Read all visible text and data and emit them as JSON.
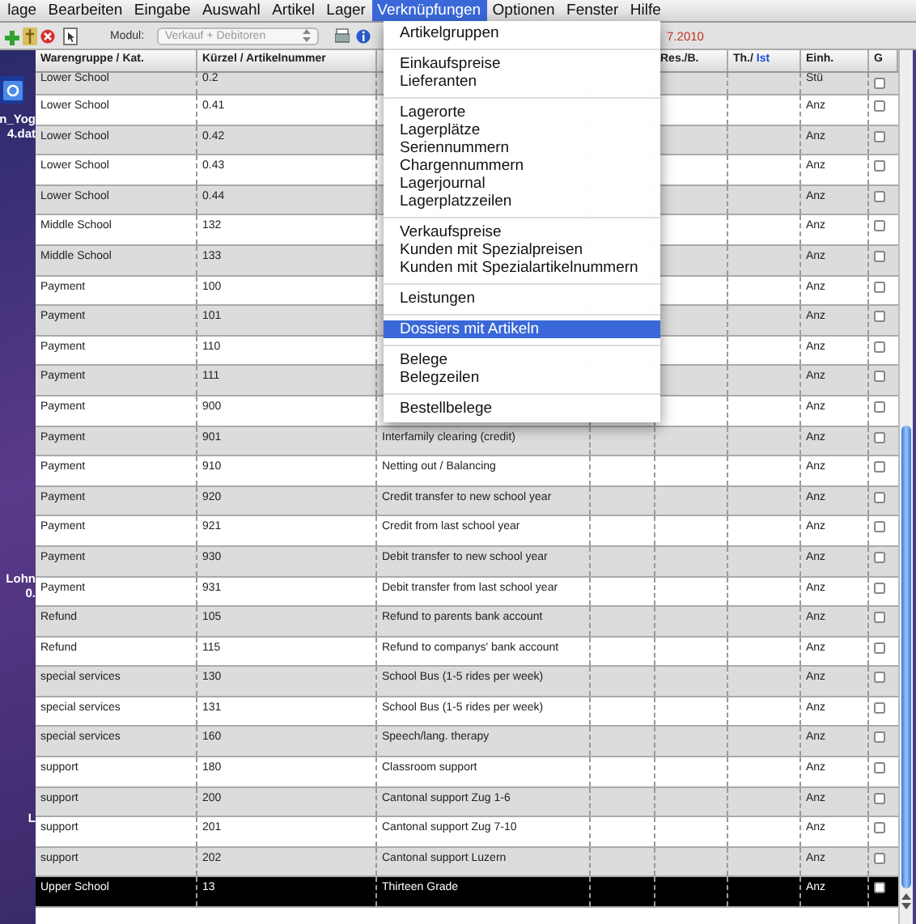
{
  "menu_bar": [
    {
      "label": "lage",
      "selected": false
    },
    {
      "label": "Bearbeiten",
      "selected": false
    },
    {
      "label": "Eingabe",
      "selected": false
    },
    {
      "label": "Auswahl",
      "selected": false
    },
    {
      "label": "Artikel",
      "selected": false
    },
    {
      "label": "Lager",
      "selected": false
    },
    {
      "label": "Verknüpfungen",
      "selected": true
    },
    {
      "label": "Optionen",
      "selected": false
    },
    {
      "label": "Fenster",
      "selected": false
    },
    {
      "label": "Hilfe",
      "selected": false
    }
  ],
  "toolbar": {
    "module_label": "Modul:",
    "module_value": "Verkauf + Debitoren",
    "date_fragment": "7.2010"
  },
  "desktop_items": [
    {
      "lines": [
        "n_Yog",
        "4.dat"
      ]
    },
    {
      "lines": [
        "Lohn",
        "0."
      ]
    },
    {
      "lines": [
        "L"
      ]
    }
  ],
  "menu": {
    "groups": [
      [
        {
          "label": "Artikelgruppen",
          "selected": false
        }
      ],
      [
        {
          "label": "Einkaufspreise",
          "selected": false
        },
        {
          "label": "Lieferanten",
          "selected": false
        }
      ],
      [
        {
          "label": "Lagerorte",
          "selected": false
        },
        {
          "label": "Lagerplätze",
          "selected": false
        },
        {
          "label": "Seriennummern",
          "selected": false
        },
        {
          "label": "Chargennummern",
          "selected": false
        },
        {
          "label": "Lagerjournal",
          "selected": false
        },
        {
          "label": "Lagerplatzzeilen",
          "selected": false
        }
      ],
      [
        {
          "label": "Verkaufspreise",
          "selected": false
        },
        {
          "label": "Kunden mit Spezialpreisen",
          "selected": false
        },
        {
          "label": "Kunden mit Spezialartikelnummern",
          "selected": false
        }
      ],
      [
        {
          "label": "Leistungen",
          "selected": false
        }
      ],
      [
        {
          "label": "Dossiers mit Artikeln",
          "selected": true
        }
      ],
      [
        {
          "label": "Belege",
          "selected": false
        },
        {
          "label": "Belegzeilen",
          "selected": false
        }
      ],
      [
        {
          "label": "Bestellbelege",
          "selected": false
        }
      ]
    ]
  },
  "table": {
    "columns": [
      {
        "label": "Warengruppe / Kat."
      },
      {
        "label": "Kürzel / Artikelnummer"
      },
      {},
      {},
      {
        "label": "Res./B."
      },
      {
        "label": "Th./",
        "label_highlight": "Ist"
      },
      {
        "label": "Einh."
      },
      {
        "label": "G"
      }
    ],
    "rows": [
      {
        "group": "Lower School",
        "code": "0.2",
        "unit": "Stü",
        "checked": false,
        "selected": false
      },
      {
        "group": "Lower School",
        "code": "0.41",
        "unit": "Anz",
        "checked": false,
        "selected": false
      },
      {
        "group": "Lower School",
        "code": "0.42",
        "unit": "Anz",
        "checked": false,
        "selected": false
      },
      {
        "group": "Lower School",
        "code": "0.43",
        "unit": "Anz",
        "checked": false,
        "selected": false
      },
      {
        "group": "Lower School",
        "code": "0.44",
        "unit": "Anz",
        "checked": false,
        "selected": false
      },
      {
        "group": "Middle School",
        "code": "132",
        "unit": "Anz",
        "checked": false,
        "selected": false
      },
      {
        "group": "Middle School",
        "code": "133",
        "unit": "Anz",
        "checked": false,
        "selected": false
      },
      {
        "group": "Payment",
        "code": "100",
        "unit": "Anz",
        "checked": false,
        "selected": false
      },
      {
        "group": "Payment",
        "code": "101",
        "unit": "Anz",
        "checked": false,
        "selected": false
      },
      {
        "group": "Payment",
        "code": "110",
        "unit": "Anz",
        "checked": false,
        "selected": false
      },
      {
        "group": "Payment",
        "code": "111",
        "unit": "Anz",
        "checked": false,
        "selected": false
      },
      {
        "group": "Payment",
        "code": "900",
        "unit": "Anz",
        "checked": false,
        "selected": false
      },
      {
        "group": "Payment",
        "code": "901",
        "description": "Interfamily clearing (credit)",
        "unit": "Anz",
        "checked": false,
        "selected": false
      },
      {
        "group": "Payment",
        "code": "910",
        "description": "Netting out / Balancing",
        "unit": "Anz",
        "checked": false,
        "selected": false
      },
      {
        "group": "Payment",
        "code": "920",
        "description": "Credit transfer to new school year",
        "unit": "Anz",
        "checked": false,
        "selected": false
      },
      {
        "group": "Payment",
        "code": "921",
        "description": "Credit from last school year",
        "unit": "Anz",
        "checked": false,
        "selected": false
      },
      {
        "group": "Payment",
        "code": "930",
        "description": "Debit transfer to new school year",
        "unit": "Anz",
        "checked": false,
        "selected": false
      },
      {
        "group": "Payment",
        "code": "931",
        "description": "Debit transfer from last school year",
        "unit": "Anz",
        "checked": false,
        "selected": false
      },
      {
        "group": "Refund",
        "code": "105",
        "description": "Refund to parents bank account",
        "unit": "Anz",
        "checked": false,
        "selected": false
      },
      {
        "group": "Refund",
        "code": "115",
        "description": "Refund to companys' bank account",
        "unit": "Anz",
        "checked": false,
        "selected": false
      },
      {
        "group": "special services",
        "code": "130",
        "description": "School Bus (1-5 rides per week)",
        "unit": "Anz",
        "checked": false,
        "selected": false
      },
      {
        "group": "special services",
        "code": "131",
        "description": "School Bus (1-5 rides per week)",
        "unit": "Anz",
        "checked": false,
        "selected": false
      },
      {
        "group": "special services",
        "code": "160",
        "description": "Speech/lang. therapy",
        "unit": "Anz",
        "checked": false,
        "selected": false
      },
      {
        "group": "support",
        "code": "180",
        "description": "Classroom support",
        "unit": "Anz",
        "checked": false,
        "selected": false
      },
      {
        "group": "support",
        "code": "200",
        "description": "Cantonal support Zug 1-6",
        "unit": "Anz",
        "checked": false,
        "selected": false
      },
      {
        "group": "support",
        "code": "201",
        "description": "Cantonal support Zug 7-10",
        "unit": "Anz",
        "checked": false,
        "selected": false
      },
      {
        "group": "support",
        "code": "202",
        "description": "Cantonal support Luzern",
        "unit": "Anz",
        "checked": false,
        "selected": false
      },
      {
        "group": "Upper School",
        "code": "13",
        "description": "Thirteen Grade",
        "unit": "Anz",
        "checked": false,
        "selected": true
      }
    ]
  }
}
